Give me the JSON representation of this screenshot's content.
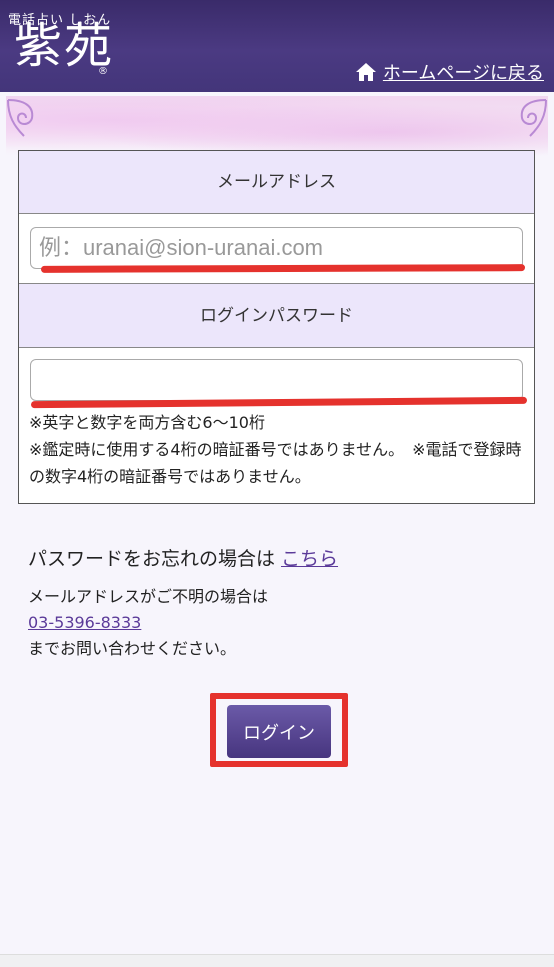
{
  "header": {
    "logo_small": "電話占い しおん",
    "logo_main": "紫苑",
    "logo_reg": "®",
    "home_link": "ホームページに戻る"
  },
  "form": {
    "email_label": "メールアドレス",
    "email_placeholder": "例：uranai@sion-uranai.com",
    "email_value": "",
    "password_label": "ログインパスワード",
    "password_value": "",
    "note1": "※英字と数字を両方含む6〜10桁",
    "note2": "※鑑定時に使用する4桁の暗証番号ではありません。　※電話で登録時の数字4桁の暗証番号ではありません。"
  },
  "forgot": {
    "text": "パスワードをお忘れの場合は",
    "link": "こちら"
  },
  "help": {
    "line1": "メールアドレスがご不明の場合は",
    "phone": "03-5396-8333",
    "line3": "までお問い合わせください。"
  },
  "login_button": "ログイン",
  "colors": {
    "header": "#43357a",
    "label_bg": "#ece6fb",
    "annotation_red": "#e5322d",
    "link": "#5b3a99"
  }
}
